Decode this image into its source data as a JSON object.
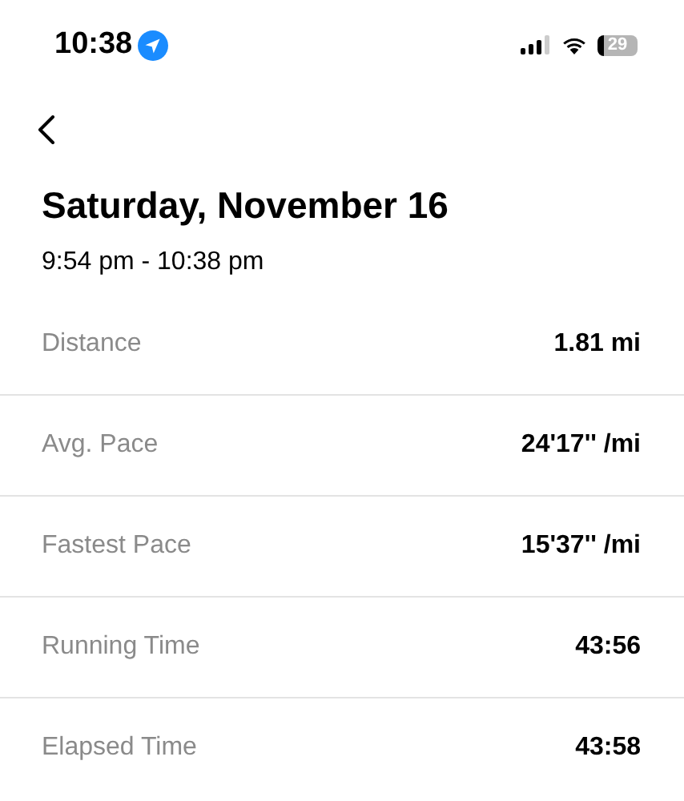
{
  "status_bar": {
    "time": "10:38",
    "battery": "29"
  },
  "header": {
    "title": "Saturday, November 16",
    "time_range": "9:54 pm - 10:38 pm"
  },
  "stats": [
    {
      "label": "Distance",
      "value": "1.81 mi"
    },
    {
      "label": "Avg. Pace",
      "value": "24'17'' /mi"
    },
    {
      "label": "Fastest Pace",
      "value": "15'37'' /mi"
    },
    {
      "label": "Running Time",
      "value": "43:56"
    },
    {
      "label": "Elapsed Time",
      "value": "43:58"
    }
  ]
}
